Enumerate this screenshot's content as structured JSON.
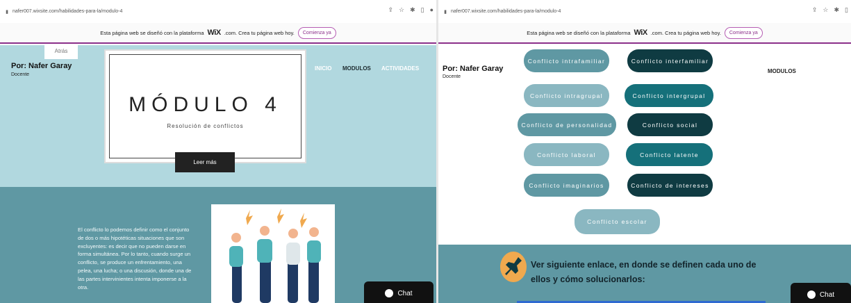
{
  "left": {
    "url": "nafer007.wixsite.com/habilidades-para-la/modulo-4",
    "wix_banner": {
      "text": "Esta página web se diseñó con la plataforma",
      "logo": "WiX",
      "suffix": ".com. Crea tu página web hoy.",
      "cta": "Comienza ya"
    },
    "back": "Atrás",
    "author": "Por: Nafer Garay",
    "role": "Docente",
    "nav": [
      "INICIO",
      "MODULOS",
      "ACTIVIDADES"
    ],
    "module_title": "MÓDULO 4",
    "module_subtitle": "Resolución de conflictos",
    "read_more": "Leer más",
    "paragraph": "El conflicto lo podemos definir como el conjunto de dos o más hipotéticas situaciones que son excluyentes: es decir que no pueden darse en forma simultánea. Por lo tanto, cuando surge un conflicto, se produce un enfrentamiento, una pelea, una lucha; o una discusión, donde una de las partes intervinientes intenta imponerse a la otra.",
    "chat": "Chat"
  },
  "right": {
    "url": "nafer007.wixsite.com/habilidades-para-la/modulo-4",
    "wix_banner": {
      "text": "Esta página web se diseñó con la plataforma",
      "logo": "WiX",
      "suffix": ".com. Crea tu página web hoy.",
      "cta": "Comienza ya"
    },
    "author": "Por: Nafer Garay",
    "role": "Docente",
    "nav_modulos": "MODULOS",
    "conflicts": [
      "Conflicto intrafamiliar",
      "Conflicto interfamiliar",
      "Conflicto intragrupal",
      "Conflicto intergrupal",
      "Conflicto de personalidad",
      "Conflicto social",
      "Conflicto laboral",
      "Conflicto latente",
      "Conflicto imaginarios",
      "Conflicto de intereses",
      "Conflicto escolar"
    ],
    "link_text": "Ver siguiente enlace, en donde se definen cada uno de ellos y cómo solucionarlos:",
    "chat": "Chat"
  },
  "colors": {
    "hero_light": "#b1d8df",
    "teal_section": "#5f98a3",
    "pill_dark": "#0f3b42",
    "pill_teal": "#15707a",
    "wix_accent": "#8b2f8a"
  }
}
